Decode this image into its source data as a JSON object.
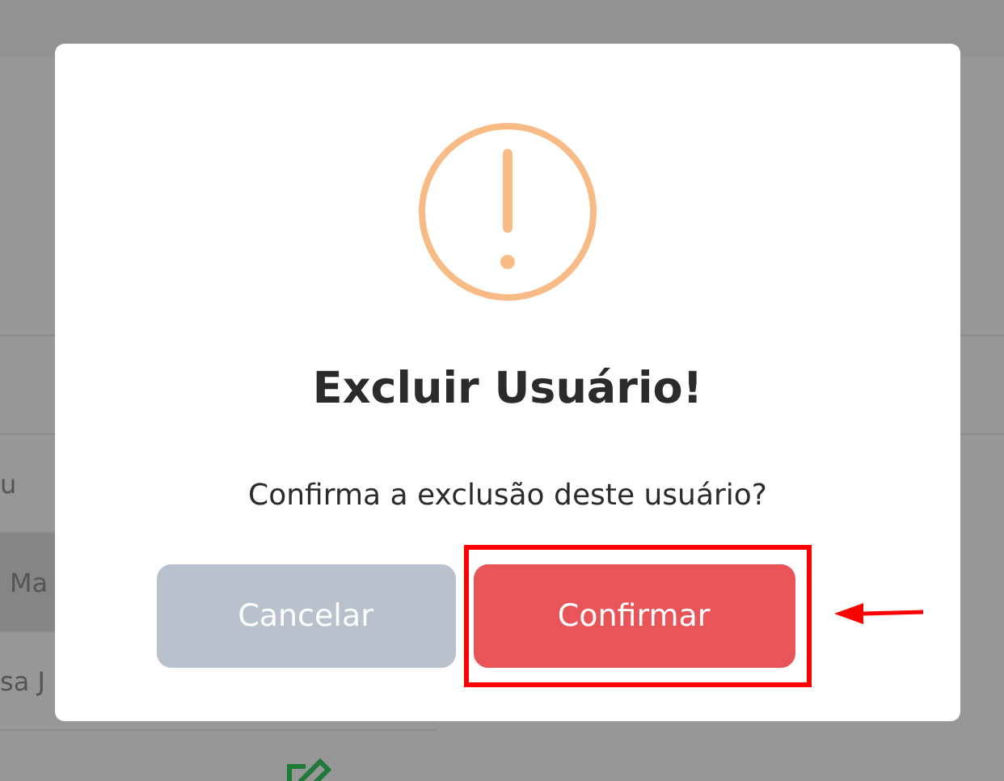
{
  "background": {
    "rows": [
      {
        "text": "u",
        "selected": false
      },
      {
        "text": "Ma",
        "selected": true
      },
      {
        "text": "sa J",
        "selected": false
      }
    ]
  },
  "dialog": {
    "title": "Excluir Usuário!",
    "message": "Confirma a exclusão deste usuário?",
    "buttons": [
      {
        "label": "Cancelar",
        "kind": "cancel"
      },
      {
        "label": "Confirmar",
        "kind": "confirm",
        "highlighted": true
      }
    ]
  }
}
